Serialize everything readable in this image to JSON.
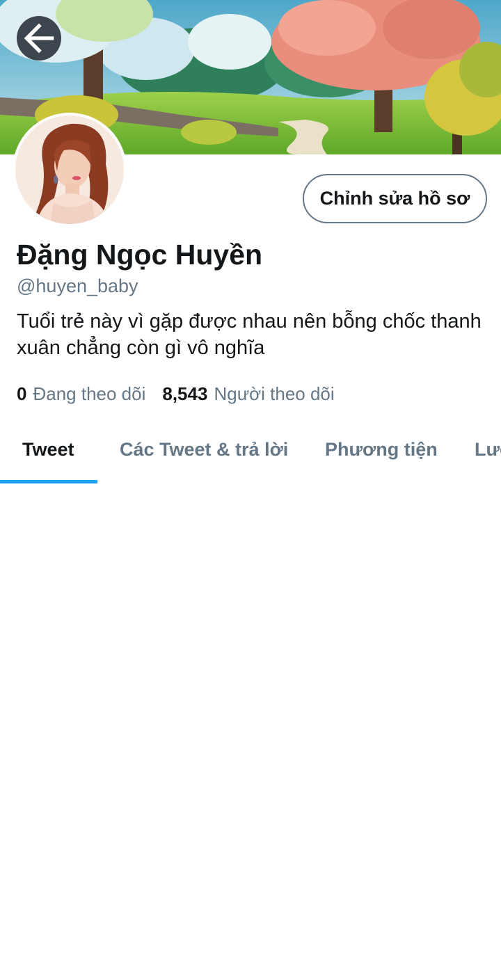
{
  "header": {
    "back_icon": "arrow-left-icon",
    "banner_image": "painted-landscape-trees-banner"
  },
  "profile": {
    "avatar_image": "profile-photo",
    "edit_button_label": "Chỉnh sửa hồ sơ",
    "display_name": "Đặng Ngọc Huyền",
    "handle": "@huyen_baby",
    "bio": "Tuổi trẻ này vì gặp được nhau nên bỗng chốc thanh xuân chẳng còn gì vô nghĩa",
    "following_count": "0",
    "following_label": "Đang theo dõi",
    "followers_count": "8,543",
    "followers_label": "Người theo dõi"
  },
  "tabs": [
    {
      "label": "Tweet",
      "active": true
    },
    {
      "label": "Các Tweet & trả lời",
      "active": false
    },
    {
      "label": "Phương tiện",
      "active": false
    },
    {
      "label": "Lượt thích",
      "active": false
    }
  ],
  "colors": {
    "accent": "#1da1f2",
    "text_primary": "#14171a",
    "text_secondary": "#657786"
  }
}
